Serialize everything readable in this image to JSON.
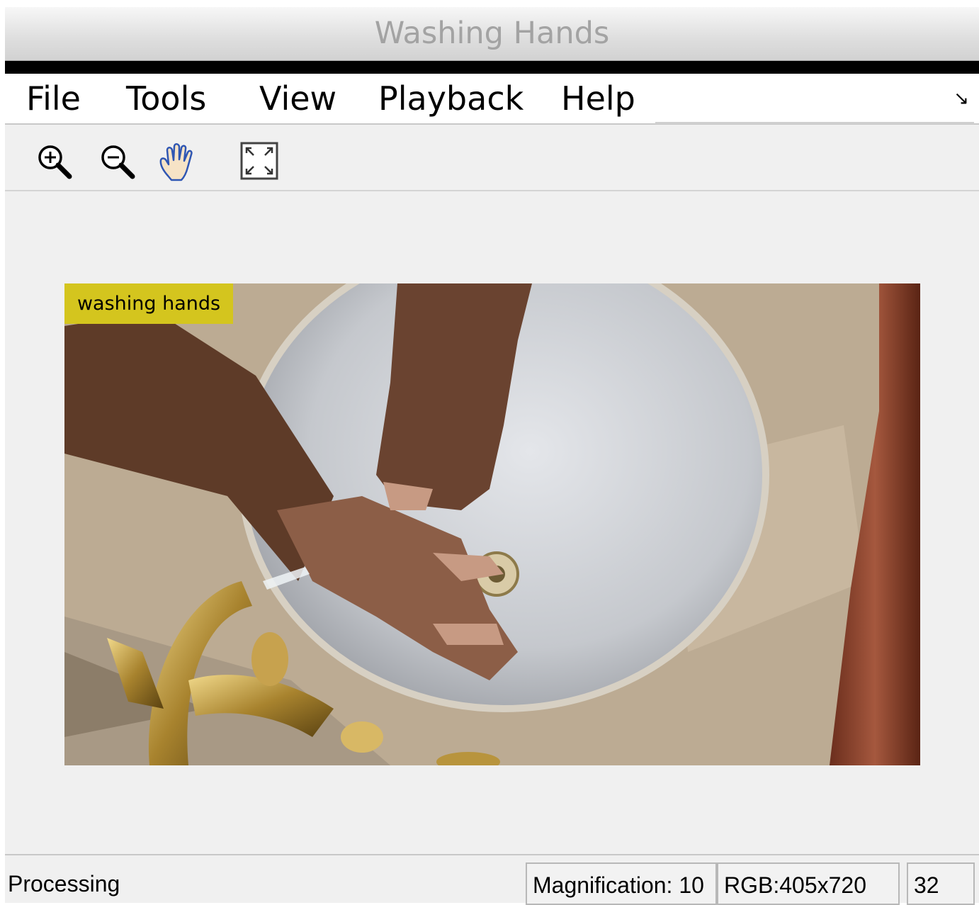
{
  "window": {
    "title": "Washing Hands"
  },
  "menu": {
    "items": [
      {
        "label": "File"
      },
      {
        "label": "Tools"
      },
      {
        "label": "View"
      },
      {
        "label": "Playback"
      },
      {
        "label": "Help"
      }
    ]
  },
  "toolbar": {
    "buttons": [
      {
        "icon": "zoom-in-icon"
      },
      {
        "icon": "zoom-out-icon"
      },
      {
        "icon": "pan-hand-icon"
      },
      {
        "icon": "fit-to-window-icon"
      }
    ]
  },
  "video": {
    "annotation_label": "washing hands",
    "label_color": "#d4c51e"
  },
  "status": {
    "text": "Processing",
    "magnification": "Magnification: 10",
    "image_info": "RGB:405x720",
    "frame": "32"
  }
}
